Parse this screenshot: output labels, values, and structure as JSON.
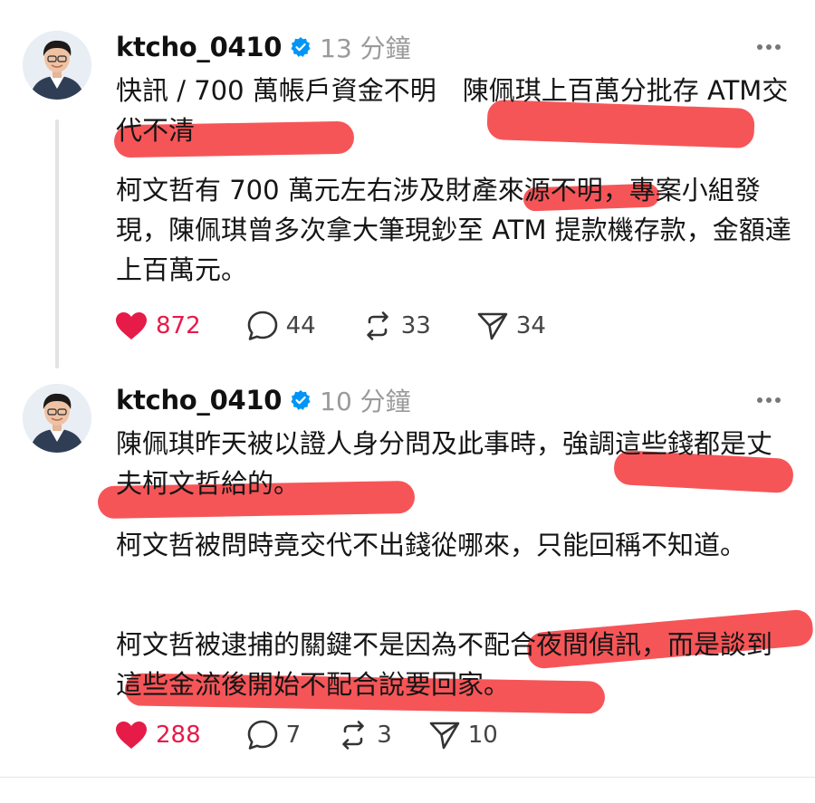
{
  "posts": [
    {
      "username": "ktcho_0410",
      "time": "13 分鐘",
      "paragraphs": [
        "快訊 / 700 萬帳戶資金不明　陳佩琪上百萬分批存 ATM交代不清",
        "柯文哲有 700 萬元左右涉及財產來源不明，專案小組發現，陳佩琪曾多次拿大筆現鈔至 ATM 提款機存款，金額達上百萬元。"
      ],
      "likes": "872",
      "comments": "44",
      "reposts": "33",
      "shares": "34"
    },
    {
      "username": "ktcho_0410",
      "time": "10 分鐘",
      "paragraphs": [
        "陳佩琪昨天被以證人身分問及此事時，強調這些錢都是丈夫柯文哲給的。",
        "柯文哲被問時竟交代不出錢從哪來，只能回稱不知道。",
        "柯文哲被逮捕的關鍵不是因為不配合夜間偵訊，而是談到這些金流後開始不配合說要回家。"
      ],
      "likes": "288",
      "comments": "7",
      "reposts": "3",
      "shares": "10"
    }
  ],
  "icons": {
    "verified": "verified-badge-icon",
    "more": "more-dots-icon",
    "like": "heart-icon",
    "comment": "comment-bubble-icon",
    "repost": "repost-icon",
    "share": "send-icon"
  },
  "colors": {
    "like_active": "#e61b48",
    "verified_blue": "#0095f6",
    "highlight_marker": "#f4373b",
    "timestamp_gray": "#9a9a9a"
  }
}
